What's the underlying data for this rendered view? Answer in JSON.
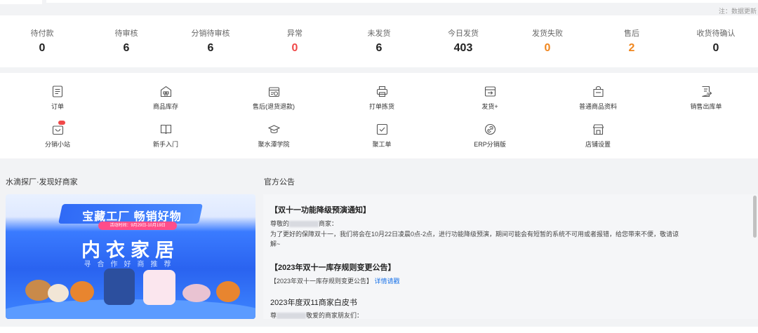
{
  "top_note": "注：数据更新",
  "stats": [
    {
      "label": "待付款",
      "value": "0",
      "color": "#222222"
    },
    {
      "label": "待审核",
      "value": "6",
      "color": "#222222"
    },
    {
      "label": "分销待审核",
      "value": "6",
      "color": "#222222"
    },
    {
      "label": "异常",
      "value": "0",
      "color": "#f04848"
    },
    {
      "label": "未发货",
      "value": "6",
      "color": "#222222"
    },
    {
      "label": "今日发货",
      "value": "403",
      "color": "#222222"
    },
    {
      "label": "发货失败",
      "value": "0",
      "color": "#f0861e"
    },
    {
      "label": "售后",
      "value": "2",
      "color": "#f0861e"
    },
    {
      "label": "收货待确认",
      "value": "0",
      "color": "#222222"
    }
  ],
  "shortcuts": {
    "order": {
      "label": "订单",
      "icon": "order-list-icon"
    },
    "inventory": {
      "label": "商品库存",
      "icon": "warehouse-icon"
    },
    "aftersale": {
      "label": "售后(退货退款)",
      "icon": "return-box-icon"
    },
    "pick": {
      "label": "打单拣货",
      "icon": "printer-icon"
    },
    "ship": {
      "label": "发货+",
      "icon": "shipping-card-icon"
    },
    "goods": {
      "label": "普通商品资料",
      "icon": "goods-bag-icon"
    },
    "outbound": {
      "label": "销售出库单",
      "icon": "outbound-doc-icon"
    },
    "dist_shop": {
      "label": "分销小站",
      "icon": "shop-bag-icon",
      "badge": "NEW"
    },
    "guide": {
      "label": "新手入门",
      "icon": "book-icon"
    },
    "academy": {
      "label": "聚水潭学院",
      "icon": "graduation-cap-icon"
    },
    "work_order": {
      "label": "聚工单",
      "icon": "checkbox-icon"
    },
    "erp": {
      "label": "ERP分销版",
      "icon": "link-icon"
    },
    "store": {
      "label": "店铺设置",
      "icon": "store-icon"
    }
  },
  "left_section": {
    "title": "水滴探厂·发现好商家"
  },
  "banner": {
    "headline": "宝藏工厂  畅销好物",
    "date": "活动时间：9月29日-10月19日",
    "title": "内衣家居",
    "subtitle": "寻合作好商推荐"
  },
  "right_section": {
    "title": "官方公告"
  },
  "notices": {
    "n1_title": "【双十一功能降级预演通知】",
    "n1_greet_a": "尊敬的",
    "n1_greet_b": "商家：",
    "n1_body": "为了更好的保障双十一，我们将会在10月22日凌晨0点-2点，进行功能降级预演，期间可能会有短暂的系统不可用或者报错，给您带来不便，敬请谅",
    "n1_body2": "解~",
    "n2_title": "【2023年双十一库存规则变更公告】",
    "n2_body": "【2023年双十一库存规则变更公告】",
    "n2_link": "详情请戳",
    "n3_title": "2023年度双11商家白皮书",
    "n3_body_a": "尊",
    "n3_body_b": "敬爱的商家朋友们："
  }
}
